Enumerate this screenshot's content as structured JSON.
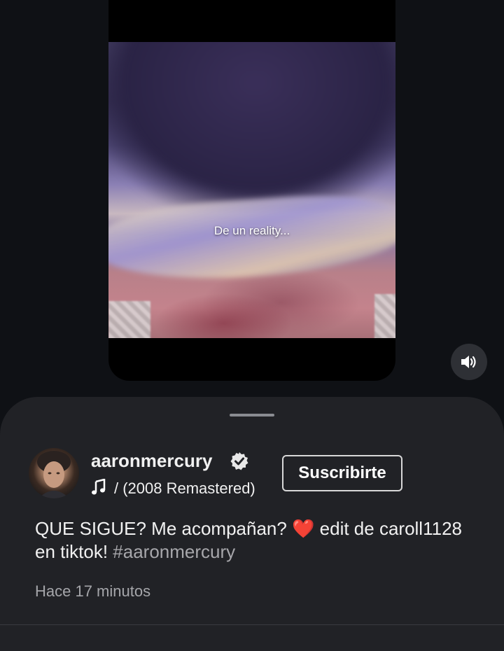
{
  "video": {
    "caption": "De un reality..."
  },
  "controls": {
    "mute_icon": "volume-icon"
  },
  "channel": {
    "name": "aaronmercury",
    "verified_icon": "verified-check-icon",
    "avatar_icon": "avatar"
  },
  "music": {
    "icon": "music-note-icon",
    "song": "/ (2008 Remastered)"
  },
  "subscribe": {
    "label": "Suscribirte"
  },
  "post": {
    "text_before": "QUE SIGUE? Me acompañan? ",
    "heart": "❤️",
    "text_after": " edit de caroll1128 en tiktok! ",
    "hashtag": "#aaronmercury",
    "timestamp": "Hace 17 minutos"
  },
  "colors": {
    "background": "#0f1115",
    "sheet": "#212226",
    "heart": "#e21b2c"
  }
}
